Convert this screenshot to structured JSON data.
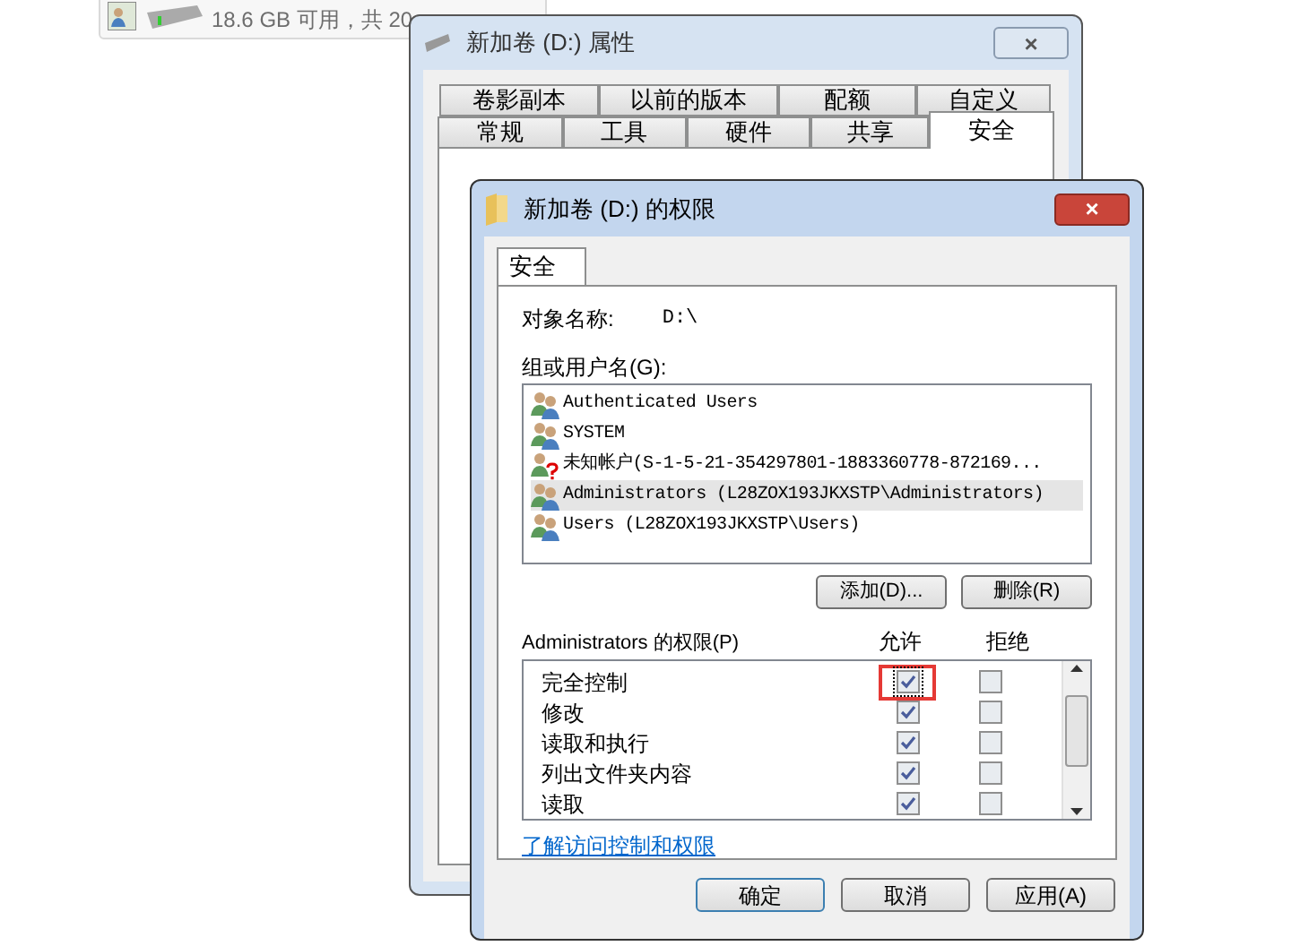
{
  "drive_item": {
    "free_space": "18.6 GB 可用，共 20"
  },
  "properties_window": {
    "title": "新加卷 (D:) 属性",
    "close": "×",
    "tabs_top": [
      {
        "label": "卷影副本",
        "selected": false
      },
      {
        "label": "以前的版本",
        "selected": false
      },
      {
        "label": "配额",
        "selected": false
      },
      {
        "label": "自定义",
        "selected": false
      }
    ],
    "tabs_bottom": [
      {
        "label": "常规",
        "selected": false
      },
      {
        "label": "工具",
        "selected": false
      },
      {
        "label": "硬件",
        "selected": false
      },
      {
        "label": "共享",
        "selected": false
      },
      {
        "label": "安全",
        "selected": true
      }
    ]
  },
  "permissions_window": {
    "title": "新加卷 (D:) 的权限",
    "close": "×",
    "tabs": [
      {
        "label": "安全",
        "selected": true
      }
    ],
    "object_name_label": "对象名称:",
    "object_name_value": "D:\\",
    "groups_label": "组或用户名(G):",
    "users": [
      {
        "name": "Authenticated Users",
        "kind": "group",
        "selected": false
      },
      {
        "name": "SYSTEM",
        "kind": "group",
        "selected": false
      },
      {
        "name": "未知帐户(S-1-5-21-354297801-1883360778-872169...",
        "kind": "unknown",
        "selected": false
      },
      {
        "name": "Administrators (L28ZOX193JKXSTP\\Administrators)",
        "kind": "group",
        "selected": true
      },
      {
        "name": "Users (L28ZOX193JKXSTP\\Users)",
        "kind": "group",
        "selected": false
      }
    ],
    "add_button": "添加(D)...",
    "remove_button": "删除(R)",
    "permissions_label": "Administrators 的权限(P)",
    "allow_header": "允许",
    "deny_header": "拒绝",
    "permissions": [
      {
        "name": "完全控制",
        "allow": true,
        "deny": false,
        "highlighted": true
      },
      {
        "name": "修改",
        "allow": true,
        "deny": false,
        "highlighted": false
      },
      {
        "name": "读取和执行",
        "allow": true,
        "deny": false,
        "highlighted": false
      },
      {
        "name": "列出文件夹内容",
        "allow": true,
        "deny": false,
        "highlighted": false
      },
      {
        "name": "读取",
        "allow": true,
        "deny": false,
        "highlighted": false
      }
    ],
    "help_link": "了解访问控制和权限",
    "buttons": [
      "确定",
      "取消",
      "应用(A)"
    ]
  }
}
